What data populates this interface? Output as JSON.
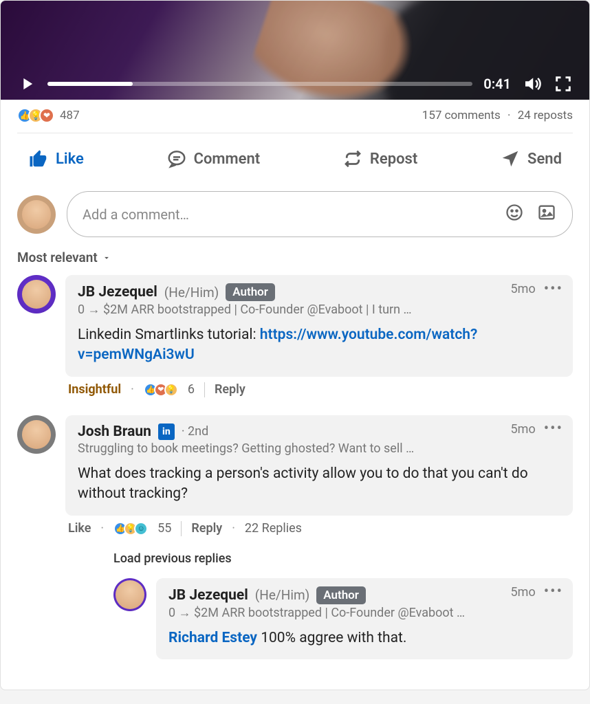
{
  "video": {
    "time": "0:41",
    "progress_pct": 20
  },
  "stats": {
    "reactions_count": "487",
    "comments_label": "157 comments",
    "reposts_label": "24 reposts"
  },
  "actions": {
    "like": "Like",
    "comment": "Comment",
    "repost": "Repost",
    "send": "Send"
  },
  "composer": {
    "placeholder": "Add a comment…"
  },
  "sort": {
    "label": "Most relevant"
  },
  "comments": [
    {
      "name": "JB Jezequel",
      "pronouns": "(He/Him)",
      "author_badge": "Author",
      "time": "5mo",
      "headline": "0 → $2M ARR bootstrapped | Co-Founder @Evaboot | I turn …",
      "text_prefix": "Linkedin Smartlinks tutorial: ",
      "link_text": "https://www.youtube.com/watch?v=pemWNgAi3wU",
      "reaction_label": "Insightful",
      "reaction_count": "6",
      "reply_label": "Reply"
    },
    {
      "name": "Josh Braun",
      "degree": "2nd",
      "time": "5mo",
      "headline": "Struggling to book meetings? Getting ghosted? Want to sell …",
      "text": "What does tracking a person's activity allow you to do that you can't do without tracking?",
      "like_label": "Like",
      "reaction_count": "55",
      "reply_label": "Reply",
      "replies_label": "22 Replies",
      "load_prev": "Load previous replies"
    },
    {
      "name": "JB Jezequel",
      "pronouns": "(He/Him)",
      "author_badge": "Author",
      "time": "5mo",
      "headline": "0 → $2M ARR bootstrapped | Co-Founder @Evaboot …",
      "mention": "Richard Estey",
      "text_after_mention": " 100% aggree with that."
    }
  ]
}
